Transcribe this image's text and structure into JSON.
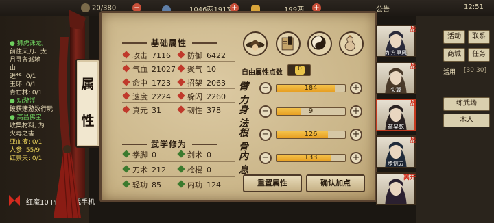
{
  "topbar": {
    "stamina": "20/380",
    "money": "1046两191文",
    "ingots": "199两",
    "announcement": "公告",
    "time": "12:51"
  },
  "left_log": [
    {
      "text": "● 狮虎诛龙,",
      "style": "gold"
    },
    {
      "text": "前往天刀、太",
      "style": "normal"
    },
    {
      "text": "月寻各派地",
      "style": "normal"
    },
    {
      "text": "山",
      "style": "normal"
    },
    {
      "text": "进华: 0/1",
      "style": "normal"
    },
    {
      "text": "玉环: 0/1",
      "style": "normal"
    },
    {
      "text": "青亡林: 0/1",
      "style": "normal"
    },
    {
      "text": "● 劝游浮",
      "style": "gold"
    },
    {
      "text": "破获赌游数行玩",
      "style": "normal"
    },
    {
      "text": "● 高昌佛宝",
      "style": "gold"
    },
    {
      "text": "收集材料, 为",
      "style": "normal"
    },
    {
      "text": "火毒之害",
      "style": "normal"
    },
    {
      "text": "亚血液: 0/1",
      "style": "yellow"
    },
    {
      "text": "人参: 55/9",
      "style": "yellow"
    },
    {
      "text": "红景天: 0/1",
      "style": "yellow"
    }
  ],
  "brand": "红魔10 Pro+游戏手机",
  "scroll_card": {
    "line1": "属",
    "line2": "性"
  },
  "basic_attrs": {
    "title": "基础属性",
    "items": [
      {
        "name": "攻击",
        "value": "7116",
        "color": "#c0392b"
      },
      {
        "name": "防御",
        "value": "6422",
        "color": "#c0392b"
      },
      {
        "name": "气血",
        "value": "21027",
        "color": "#c0392b"
      },
      {
        "name": "聚气",
        "value": "10",
        "color": "#c0392b"
      },
      {
        "name": "命中",
        "value": "1723",
        "color": "#c0392b"
      },
      {
        "name": "招架",
        "value": "2063",
        "color": "#c0392b"
      },
      {
        "name": "速度",
        "value": "2224",
        "color": "#c0392b"
      },
      {
        "name": "躲闪",
        "value": "2260",
        "color": "#c0392b"
      },
      {
        "name": "真元",
        "value": "31",
        "color": "#c0392b"
      },
      {
        "name": "韧性",
        "value": "378",
        "color": "#c0392b"
      }
    ]
  },
  "martial_attrs": {
    "title": "武学修为",
    "items": [
      {
        "name": "拳脚",
        "value": "0",
        "color": "#3b7a2e"
      },
      {
        "name": "剑术",
        "value": "0",
        "color": "#3b7a2e"
      },
      {
        "name": "刀术",
        "value": "212",
        "color": "#3b7a2e"
      },
      {
        "name": "枪棍",
        "value": "0",
        "color": "#3b7a2e"
      },
      {
        "name": "轻功",
        "value": "85",
        "color": "#3b7a2e"
      },
      {
        "name": "内功",
        "value": "124",
        "color": "#3b7a2e"
      }
    ]
  },
  "icons": [
    "hat-skill-icon",
    "book-skill-icon",
    "taichi-skill-icon",
    "gourd-skill-icon"
  ],
  "free_points": {
    "label": "自由属性点数",
    "value": "0"
  },
  "attr_rows": [
    {
      "label": "臂力",
      "value": "184",
      "fraction": 0.85
    },
    {
      "label": "身法",
      "value": "9",
      "fraction": 0.35
    },
    {
      "label": "根骨",
      "value": "126",
      "fraction": 0.75
    },
    {
      "label": "内息",
      "value": "133",
      "fraction": 0.8
    }
  ],
  "buttons": {
    "reset": "重置属性",
    "confirm": "确认加点"
  },
  "roster": [
    {
      "name": "九方里风",
      "tag": "战"
    },
    {
      "name": "尖翼",
      "tag": "战"
    },
    {
      "name": "商昊乾",
      "tag": "战"
    },
    {
      "name": "步惊云",
      "tag": "战"
    },
    {
      "name": "",
      "tag": "离开"
    }
  ],
  "right_panel": {
    "activity": "活动",
    "ranking": "联系",
    "trade": "商城",
    "quest": "任务",
    "active": "活用",
    "time_badge": "[30:30]",
    "practice": "练武场",
    "dummy": "木人"
  }
}
